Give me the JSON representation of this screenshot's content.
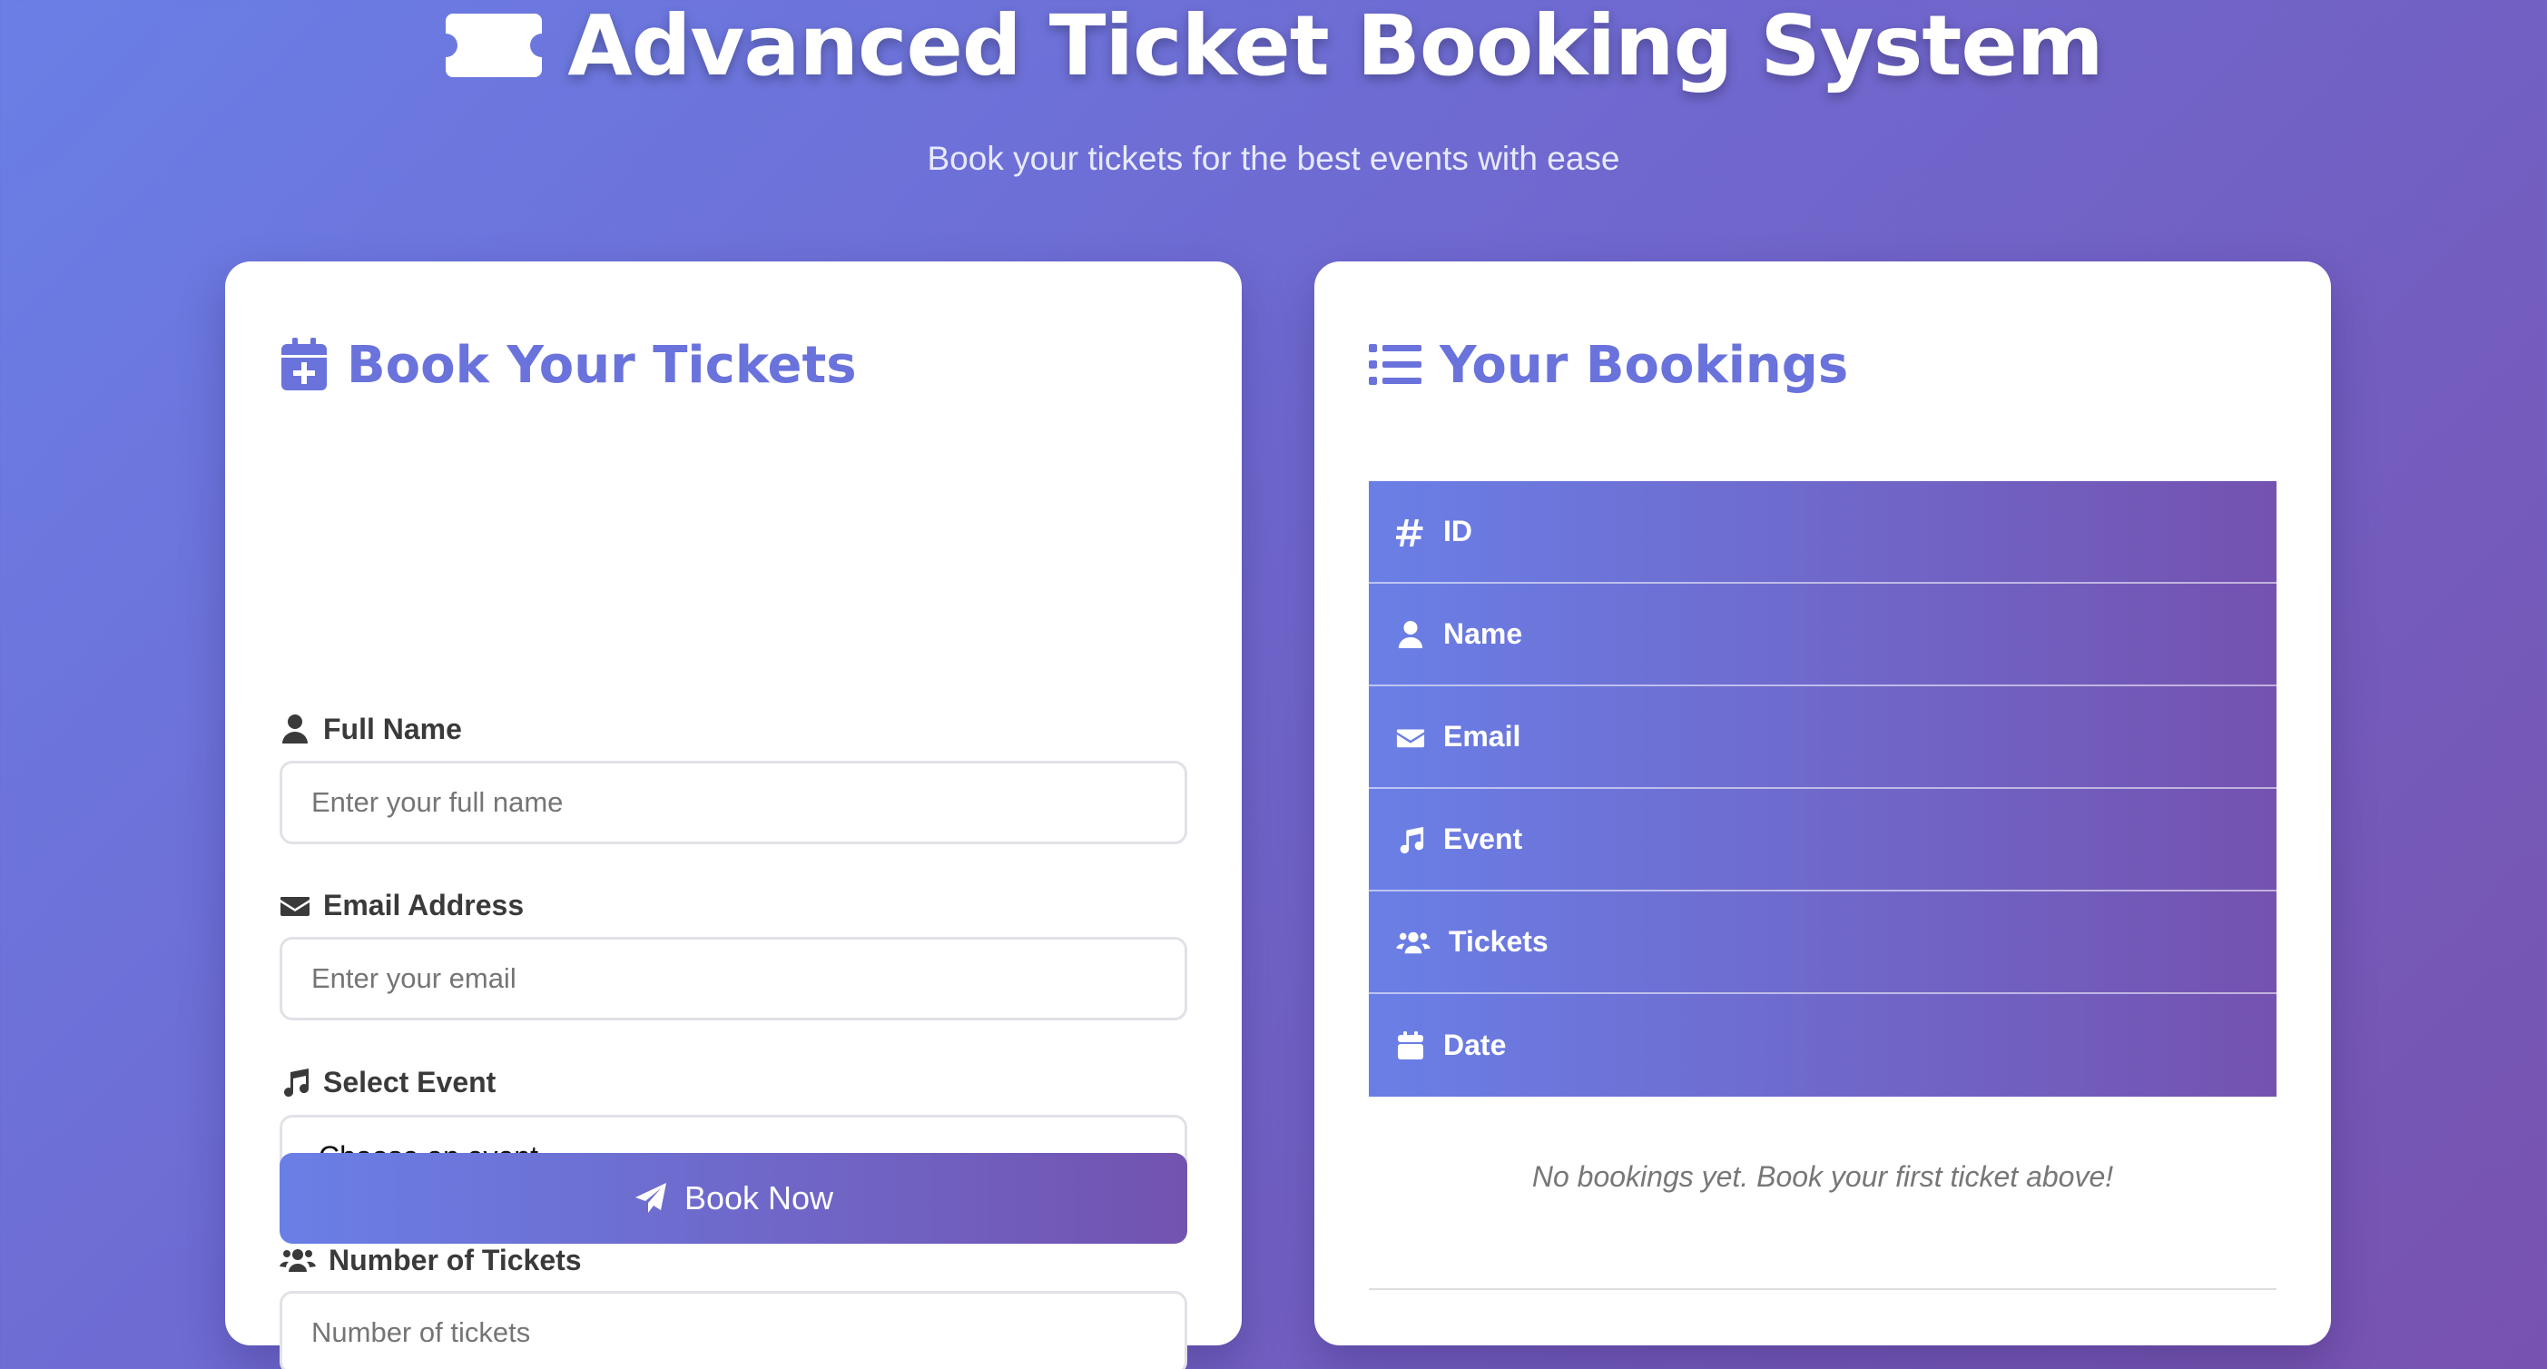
{
  "header": {
    "title": "Advanced Ticket Booking System",
    "subtitle": "Book your tickets for the best events with ease",
    "icon": "ticket-icon"
  },
  "booking_form": {
    "title": "Book Your Tickets",
    "icon": "calendar-plus-icon",
    "fields": {
      "name": {
        "label": "Full Name",
        "placeholder": "Enter your full name",
        "icon": "user-icon"
      },
      "email": {
        "label": "Email Address",
        "placeholder": "Enter your email",
        "icon": "envelope-icon"
      },
      "event": {
        "label": "Select Event",
        "value": "Choose an event",
        "icon": "music-icon"
      },
      "tickets": {
        "label": "Number of Tickets",
        "placeholder": "Number of tickets",
        "icon": "users-icon"
      }
    },
    "submit_label": "Book Now",
    "submit_icon": "paper-plane-icon"
  },
  "bookings": {
    "title": "Your Bookings",
    "icon": "list-icon",
    "columns": [
      {
        "label": "ID",
        "icon": "hashtag-icon"
      },
      {
        "label": "Name",
        "icon": "user-icon"
      },
      {
        "label": "Email",
        "icon": "envelope-icon"
      },
      {
        "label": "Event",
        "icon": "music-icon"
      },
      {
        "label": "Tickets",
        "icon": "users-icon"
      },
      {
        "label": "Date",
        "icon": "calendar-icon"
      }
    ],
    "empty_message": "No bookings yet. Book your first ticket above!"
  },
  "colors": {
    "accent": "#6a72dc",
    "gradient_start": "#6a7fe6",
    "gradient_end": "#7452b0"
  }
}
